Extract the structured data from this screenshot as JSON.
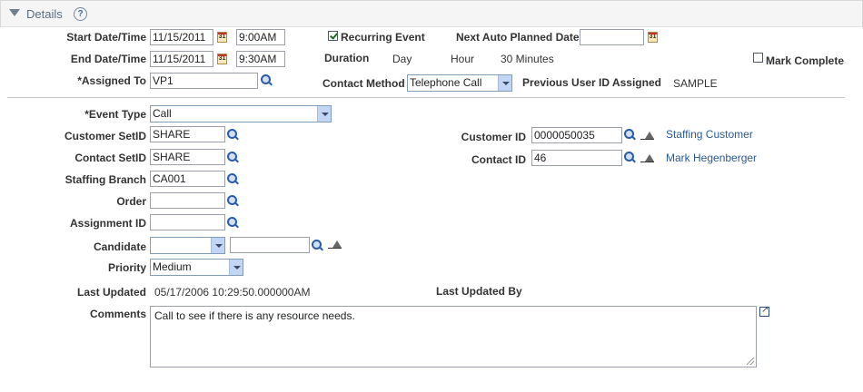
{
  "header": {
    "title": "Details",
    "help": "?"
  },
  "top": {
    "start_label": "Start Date/Time",
    "start_date": "11/15/2011",
    "start_time": "9:00AM",
    "end_label": "End Date/Time",
    "end_date": "11/15/2011",
    "end_time": "9:30AM",
    "assigned_label": "*Assigned To",
    "assigned_value": "VP1",
    "recurring_label": "Recurring Event",
    "recurring_checked": true,
    "duration_label": "Duration",
    "duration_day": "Day",
    "duration_hour": "Hour",
    "duration_minutes": "30 Minutes",
    "contact_method_label": "Contact Method",
    "contact_method_value": "Telephone Call",
    "next_auto_label": "Next Auto Planned Date",
    "next_auto_value": "",
    "prev_user_label": "Previous User ID Assigned",
    "prev_user_value": "SAMPLE",
    "mark_complete_label": "Mark Complete",
    "mark_complete_checked": false
  },
  "main": {
    "event_type_label": "*Event Type",
    "event_type_value": "Call",
    "customer_setid_label": "Customer SetID",
    "customer_setid_value": "SHARE",
    "contact_setid_label": "Contact SetID",
    "contact_setid_value": "SHARE",
    "staffing_branch_label": "Staffing Branch",
    "staffing_branch_value": "CA001",
    "order_label": "Order",
    "order_value": "",
    "assignment_label": "Assignment ID",
    "assignment_value": "",
    "candidate_label": "Candidate",
    "candidate_select_value": "",
    "candidate_value": "",
    "priority_label": "Priority",
    "priority_value": "Medium",
    "last_updated_label": "Last Updated",
    "last_updated_value": "05/17/2006 10:29:50.000000AM",
    "last_updated_by_label": "Last Updated By",
    "last_updated_by_value": "",
    "customer_id_label": "Customer ID",
    "customer_id_value": "0000050035",
    "customer_link": "Staffing Customer",
    "contact_id_label": "Contact ID",
    "contact_id_value": "46",
    "contact_link": "Mark Hegenberger",
    "comments_label": "Comments",
    "comments_value": "Call to see if there is any resource needs."
  },
  "icons": {
    "lookup": "magnifier-icon",
    "calendar": "calendar-icon",
    "clear": "eraser-icon",
    "expand": "expand-icon",
    "collapse": "collapse-triangle-icon"
  },
  "colors": {
    "link": "#2a5a95",
    "header_bg": "#f5f5f5",
    "select_arrow": "#c3d5f4"
  }
}
